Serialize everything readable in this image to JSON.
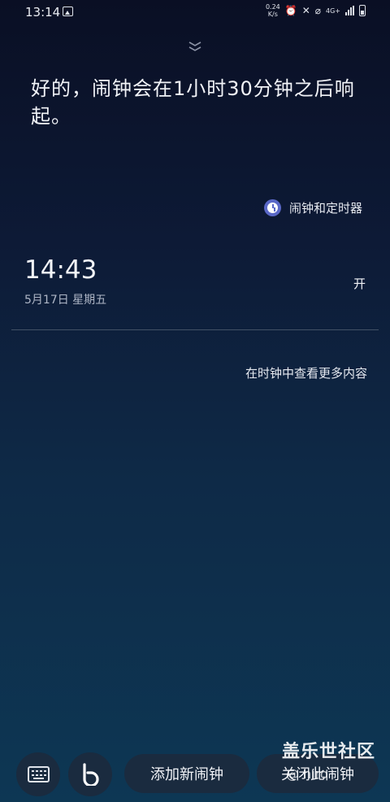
{
  "status_bar": {
    "time": "13:14",
    "net_speed_value": "0.24",
    "net_speed_unit": "K/s",
    "network": "4G+",
    "icons": [
      "gallery-icon",
      "alarm-icon",
      "mute-icon",
      "wifi-off-icon",
      "signal-icon",
      "battery-icon"
    ]
  },
  "assistant": {
    "response": "好的，闹钟会在1小时30分钟之后响起。"
  },
  "card": {
    "app_label": "闹钟和定时器",
    "alarm": {
      "time": "14:43",
      "date": "5月17日 星期五",
      "state": "开"
    },
    "more_link": "在时钟中查看更多内容"
  },
  "actions": {
    "add_alarm": "添加新闹钟",
    "close_alarm": "关闭此闹钟"
  },
  "watermark": {
    "title": "盖乐世社区",
    "subtitle": "@ hiro"
  },
  "colors": {
    "accent_clock": "#5a68c7",
    "button_bg": "#1a2b3f"
  }
}
